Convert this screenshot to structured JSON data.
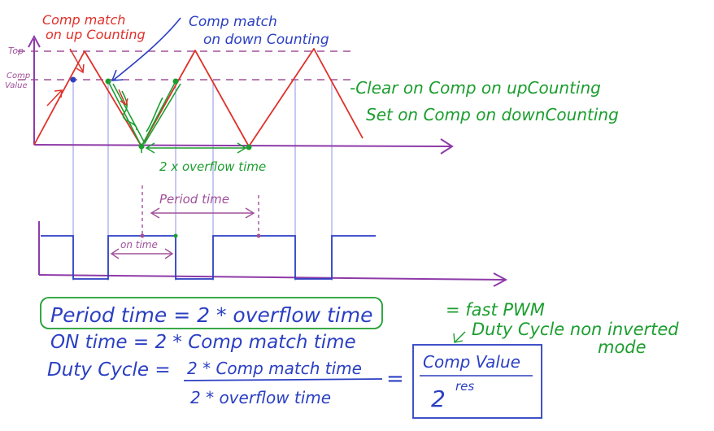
{
  "colors": {
    "wave": "#e0302a",
    "axis": "#8e3aa8",
    "grid": "#6f74e0",
    "pwm": "#2b3fc2",
    "note": "#1c9e2f",
    "formula": "#2b3fc2",
    "dashed_ref": "#a0509a"
  },
  "labels": {
    "comp_match_up": [
      "Comp match",
      "on up Counting"
    ],
    "comp_match_down": [
      "Comp match",
      "on down Counting"
    ],
    "top": "Top",
    "comp_value": [
      "Comp",
      "Value"
    ],
    "clear_on_comp": "-Clear on Comp on upCounting",
    "set_on_comp": "Set on Comp on downCounting",
    "overflow_time": "2 x overflow time",
    "period_time": "Period time",
    "on_time": "on time"
  },
  "formulas": {
    "period_time": "Period time = 2 * overflow time",
    "on_time": "ON time = 2 * Comp match time",
    "duty_cycle_left": "Duty Cycle =",
    "duty_numerator": "2 * Comp match time",
    "duty_denominator": "2 * overflow time",
    "equals": "=",
    "boxed_numerator": "Comp Value",
    "boxed_base": "2",
    "boxed_exponent": "res"
  },
  "notes": {
    "fast_pwm": "= fast PWM",
    "duty_cycle_mode": [
      "Duty Cycle non inverted",
      "mode"
    ]
  }
}
